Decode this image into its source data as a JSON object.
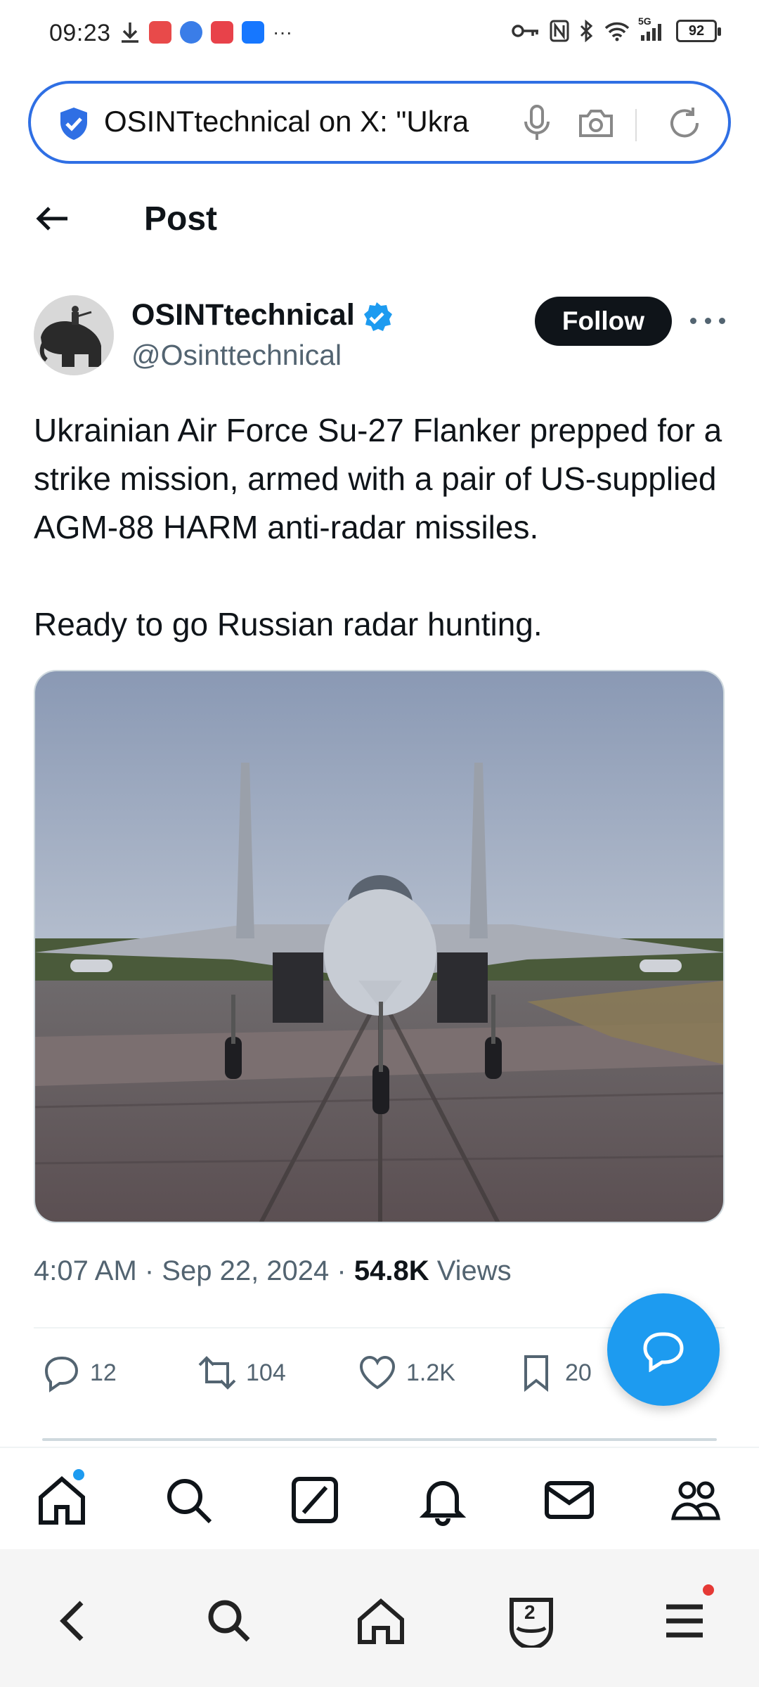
{
  "status_bar": {
    "time": "09:23",
    "battery": "92",
    "network": "5G",
    "more": "···"
  },
  "address_bar": {
    "url_text": "OSINTtechnical on X: \"Ukra"
  },
  "header": {
    "title": "Post"
  },
  "post": {
    "author_name": "OSINTtechnical",
    "author_handle": "@Osinttechnical",
    "follow_label": "Follow",
    "text_line1": "Ukrainian Air Force Su-27 Flanker prepped for a strike mission, armed with a pair of US-supplied AGM-88 HARM anti-radar missiles.",
    "text_line2": "Ready to go Russian radar hunting.",
    "timestamp": "4:07 AM · Sep 22, 2024 · ",
    "views_count": "54.8K",
    "views_label": " Views",
    "stats": {
      "replies": "12",
      "reposts": "104",
      "likes": "1.2K",
      "bookmarks": "20"
    }
  },
  "icons": {
    "status": [
      "download-icon",
      "key-icon",
      "nfc-icon",
      "bluetooth-icon",
      "wifi-icon",
      "signal-icon",
      "battery-icon"
    ],
    "address": [
      "shield-icon",
      "microphone-icon",
      "camera-icon",
      "reload-icon"
    ],
    "tabs": [
      "home-icon",
      "search-icon",
      "grok-icon",
      "bell-icon",
      "mail-icon",
      "communities-icon"
    ],
    "system": [
      "back-icon",
      "search-icon",
      "home-icon",
      "tabs-icon",
      "menu-icon"
    ]
  },
  "system_nav": {
    "tab_count": "2"
  },
  "colors": {
    "accent": "#1d9bf0",
    "address_border": "#2f6fe4",
    "text_primary": "#0f1419",
    "text_secondary": "#536471"
  }
}
